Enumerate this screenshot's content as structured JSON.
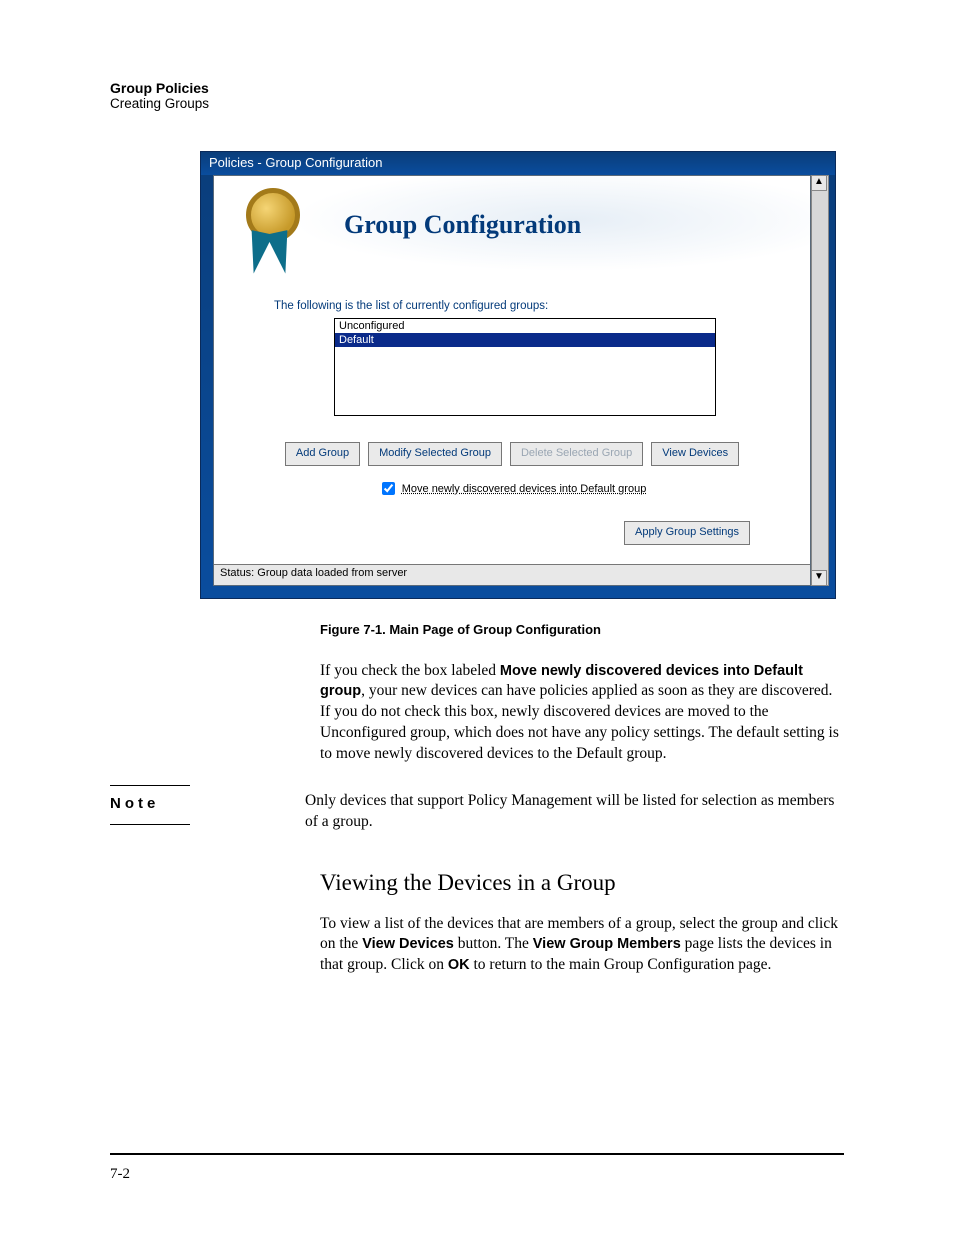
{
  "header": {
    "title": "Group Policies",
    "subtitle": "Creating Groups"
  },
  "app": {
    "window_title": "Policies - Group Configuration",
    "banner_title": "Group Configuration",
    "intro": "The following is the list of currently configured groups:",
    "list": {
      "items": [
        "Unconfigured",
        "Default"
      ],
      "selected_index": 1
    },
    "buttons": {
      "add": "Add Group",
      "modify": "Modify Selected Group",
      "delete": "Delete Selected Group",
      "view": "View Devices",
      "apply": "Apply Group Settings"
    },
    "checkbox": {
      "checked": true,
      "label": "Move newly discovered devices into Default group"
    },
    "status": "Status:  Group data loaded from server"
  },
  "doc": {
    "figure_caption": "Figure 7-1.   Main Page of Group Configuration",
    "para1_a": "If you check the box labeled ",
    "para1_bold": "Move newly discovered devices into Default group",
    "para1_b": ", your new devices can have policies applied as soon as they are discovered. If you do not check this box, newly discovered devices are moved to the Unconfigured group, which does not have any policy settings. The default setting is to move newly discovered devices to the Default group.",
    "note_label": "Note",
    "note_body": "Only devices that support Policy Management will be listed for selection as members of a group.",
    "h2": "Viewing the Devices in a Group",
    "para2_a": "To view a list of the devices that are members of a group, select the group and click on the ",
    "para2_b1": "View Devices",
    "para2_c": " button. The ",
    "para2_b2": "View Group Members",
    "para2_d": " page lists the devices in that group. Click on ",
    "para2_b3": "OK",
    "para2_e": " to return to the main Group Configuration page."
  },
  "footer": {
    "page_number": "7-2"
  }
}
